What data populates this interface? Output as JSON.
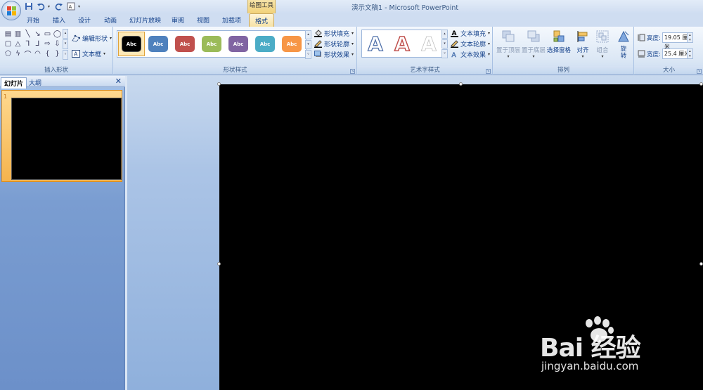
{
  "window": {
    "title": "演示文稿1 - Microsoft PowerPoint",
    "context_tab_label": "绘图工具"
  },
  "tabs": [
    "开始",
    "插入",
    "设计",
    "动画",
    "幻灯片放映",
    "审阅",
    "视图",
    "加载项",
    "格式"
  ],
  "active_tab": "格式",
  "ribbon": {
    "insert_shapes": {
      "label": "插入形状",
      "edit_shape": "编辑形状",
      "text_box": "文本框"
    },
    "shape_styles": {
      "label": "形状样式",
      "swatch_text": "Abc",
      "swatch_colors": [
        "#000000",
        "#4f81bd",
        "#c0504d",
        "#9bbb59",
        "#8064a2",
        "#4bacc6",
        "#f79646"
      ],
      "shape_fill": "形状填充",
      "shape_outline": "形状轮廓",
      "shape_effects": "形状效果"
    },
    "wordart_styles": {
      "label": "艺术字样式",
      "glyph": "A",
      "text_fill": "文本填充",
      "text_outline": "文本轮廓",
      "text_effects": "文本效果"
    },
    "arrange": {
      "label": "排列",
      "bring_front": "置于顶层",
      "send_back": "置于底层",
      "selection_pane": "选择窗格",
      "align": "对齐",
      "group": "组合",
      "rotate": "旋转"
    },
    "size": {
      "label": "大小",
      "height_label": "高度:",
      "height_value": "19.05 厘米",
      "width_label": "宽度:",
      "width_value": "25.4 厘米"
    }
  },
  "left_panel": {
    "tab_slides": "幻灯片",
    "tab_outline": "大纲",
    "slide_number": "1"
  },
  "watermark": {
    "main": "Bai 经验",
    "sub": "jingyan.baidu.com"
  }
}
